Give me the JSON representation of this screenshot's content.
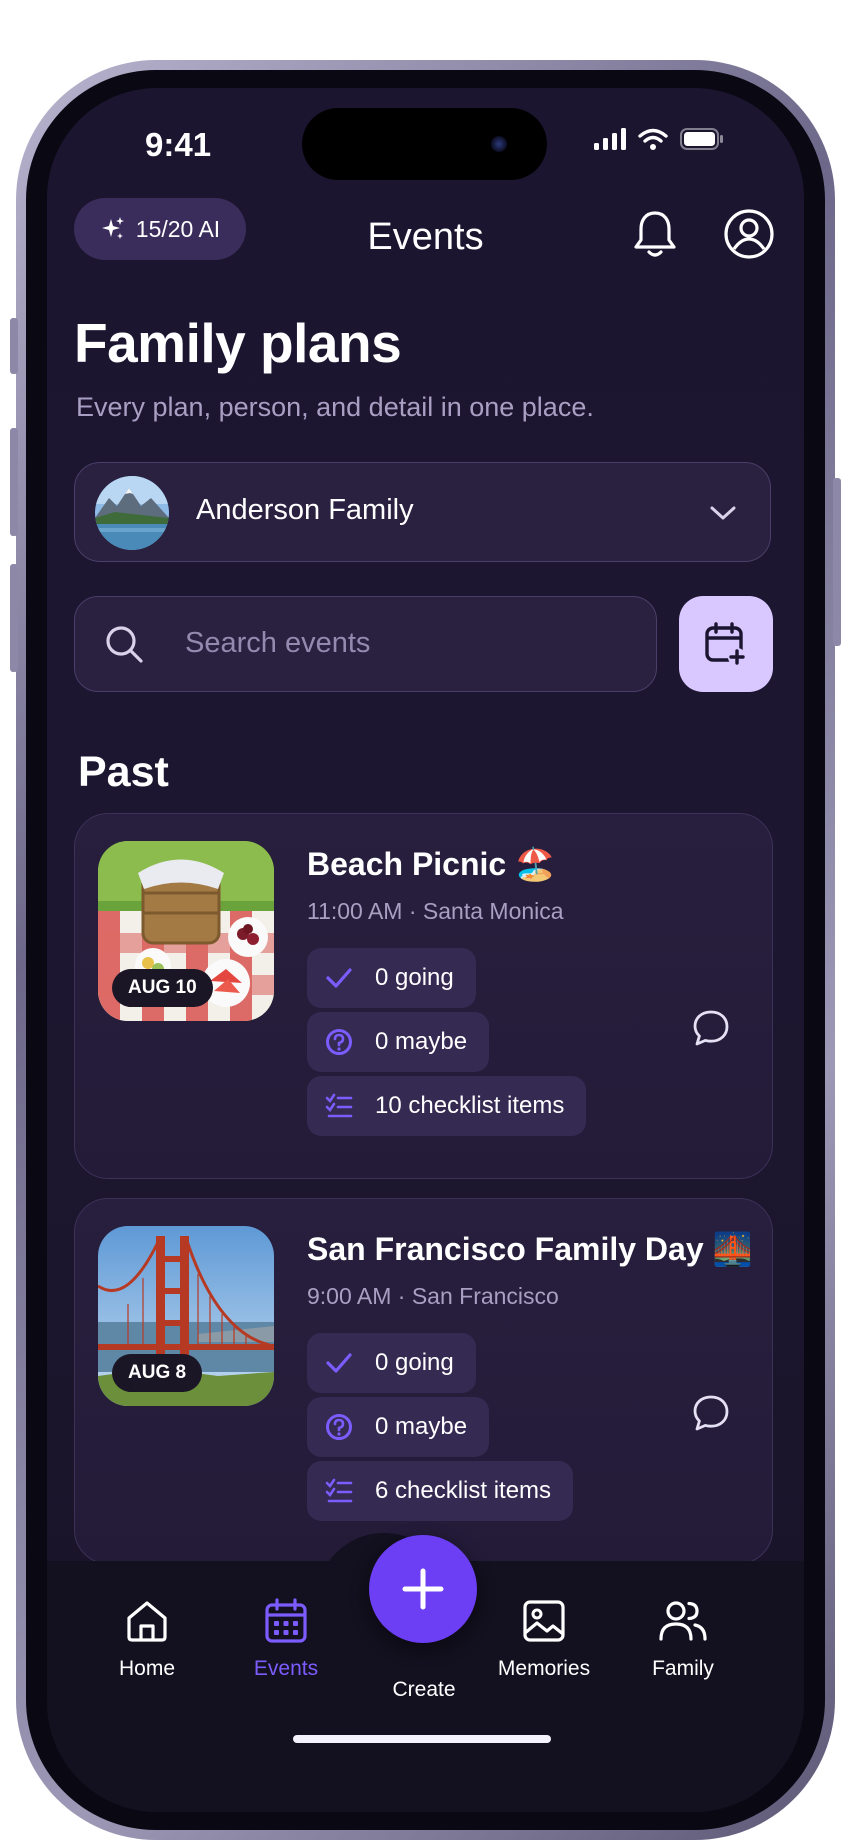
{
  "status_bar": {
    "time": "9:41"
  },
  "header": {
    "ai_usage": "15/20 AI",
    "title": "Events"
  },
  "page": {
    "title": "Family plans",
    "subtitle": "Every plan, person, and detail in one place."
  },
  "family_selector": {
    "name": "Anderson Family"
  },
  "search": {
    "placeholder": "Search events"
  },
  "section_past": {
    "title": "Past"
  },
  "events": [
    {
      "title": "Beach Picnic 🏖️",
      "meta": "11:00 AM · Santa Monica",
      "date": "AUG 10",
      "going": "0 going",
      "maybe": "0 maybe",
      "checklist": "10 checklist items"
    },
    {
      "title": "San Francisco Family Day 🌉",
      "meta": "9:00 AM · San Francisco",
      "date": "AUG 8",
      "going": "0 going",
      "maybe": "0 maybe",
      "checklist": "6 checklist items"
    }
  ],
  "tabbar": {
    "home": "Home",
    "events": "Events",
    "create": "Create",
    "memories": "Memories",
    "family": "Family",
    "active": "events"
  },
  "colors": {
    "background": "#1b1530",
    "accent": "#7c5cff",
    "fab": "#6c3ff5",
    "chip": "#352a52",
    "add_button": "#d9c8ff"
  },
  "icons": [
    "sparkle-icon",
    "bell-icon",
    "profile-icon",
    "chevron-down-icon",
    "search-icon",
    "calendar-plus-icon",
    "check-icon",
    "question-icon",
    "checklist-icon",
    "comment-icon",
    "home-icon",
    "calendar-icon",
    "plus-icon",
    "image-icon",
    "users-icon"
  ]
}
